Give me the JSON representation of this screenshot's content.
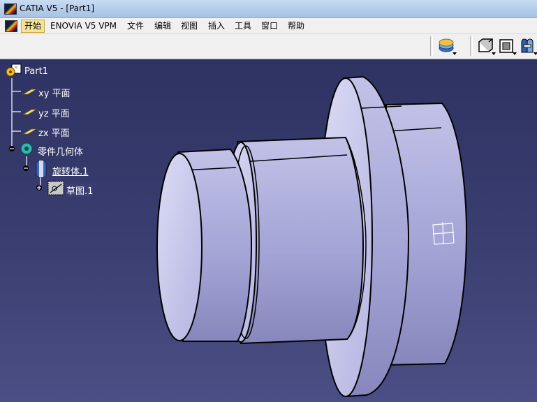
{
  "window": {
    "title": "CATIA V5 - [Part1]"
  },
  "menubar": {
    "items": [
      "开始",
      "ENOVIA V5 VPM",
      "文件",
      "编辑",
      "视图",
      "插入",
      "工具",
      "窗口",
      "帮助"
    ],
    "active_index": 0
  },
  "toolbar": {
    "icons": [
      "apply-material-icon",
      "front-view-icon",
      "normal-view-icon",
      "shading-view-icon"
    ]
  },
  "spec_tree": {
    "root": "Part1",
    "planes": [
      "xy 平面",
      "yz 平面",
      "zx 平面"
    ],
    "body": "零件几何体",
    "shaft": "旋转体.1",
    "sketch": "草图.1"
  },
  "colors": {
    "background_top": "#2f3363",
    "background_bottom": "#4b4f85",
    "part_fill": "#a9a9d8",
    "part_face": "#d0d0f0",
    "tree_line": "#ffffff"
  }
}
